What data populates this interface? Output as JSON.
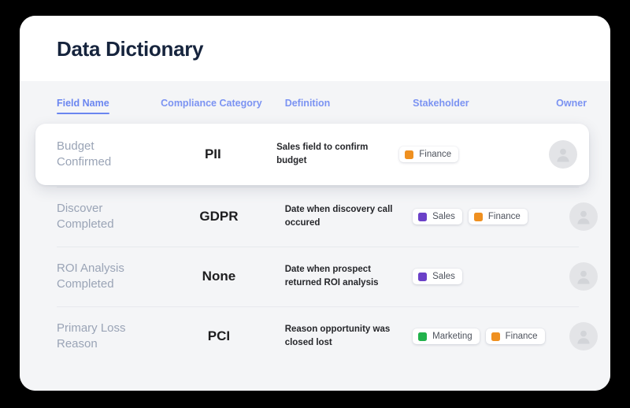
{
  "header": {
    "title": "Data Dictionary"
  },
  "table": {
    "columns": [
      {
        "label": "Field Name",
        "name": "field-name",
        "active": true
      },
      {
        "label": "Compliance Category",
        "name": "compliance-category",
        "active": false
      },
      {
        "label": "Definition",
        "name": "definition",
        "active": false
      },
      {
        "label": "Stakeholder",
        "name": "stakeholder",
        "active": false
      },
      {
        "label": "Owner",
        "name": "owner",
        "active": false
      }
    ],
    "rows": [
      {
        "field_name": "Budget Confirmed",
        "compliance_category": "PII",
        "definition": "Sales field to confirm budget",
        "stakeholders": [
          {
            "label": "Finance",
            "color": "#ef9020"
          }
        ],
        "owner_icon": "user-avatar-icon",
        "highlighted": true
      },
      {
        "field_name": "Discover Completed",
        "compliance_category": "GDPR",
        "definition": "Date when discovery call occured",
        "stakeholders": [
          {
            "label": "Sales",
            "color": "#6b41c8"
          },
          {
            "label": "Finance",
            "color": "#ef9020"
          }
        ],
        "owner_icon": "user-avatar-icon",
        "highlighted": false
      },
      {
        "field_name": "ROI Analysis Completed",
        "compliance_category": "None",
        "definition": "Date when prospect returned ROI analysis",
        "stakeholders": [
          {
            "label": "Sales",
            "color": "#6b41c8"
          }
        ],
        "owner_icon": "user-avatar-icon",
        "highlighted": false
      },
      {
        "field_name": "Primary Loss Reason",
        "compliance_category": "PCI",
        "definition": "Reason opportunity was closed lost",
        "stakeholders": [
          {
            "label": "Marketing",
            "color": "#22b24c"
          },
          {
            "label": "Finance",
            "color": "#ef9020"
          }
        ],
        "owner_icon": "user-avatar-icon",
        "highlighted": false
      }
    ]
  },
  "theme": {
    "accent": "#6b86f0",
    "page_background": "#000000",
    "card_background": "#ffffff",
    "table_background": "#f4f5f7",
    "title_color": "#16243d",
    "field_name_color": "#9aa4b6"
  }
}
